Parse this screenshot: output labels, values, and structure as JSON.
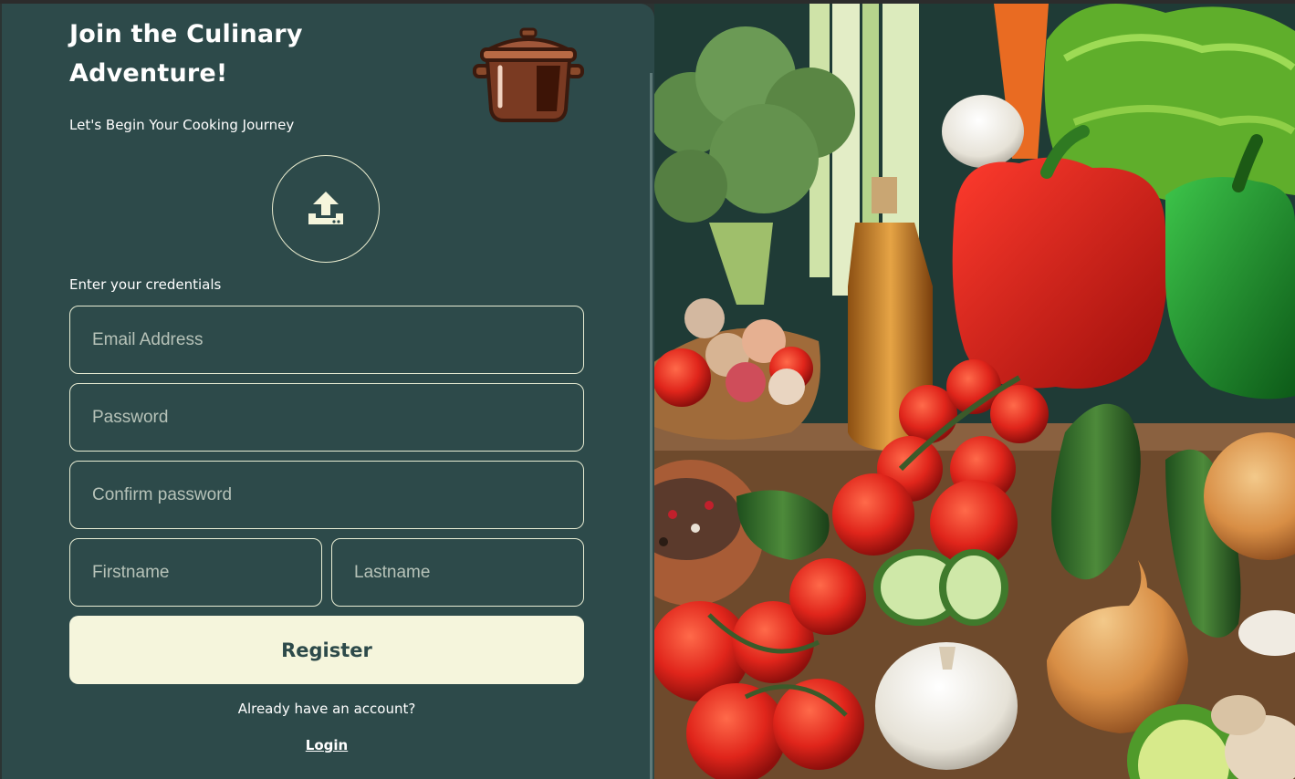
{
  "form": {
    "title": "Join the Culinary Adventure!",
    "subtitle": "Let's Begin Your Cooking Journey",
    "credentials_label": "Enter your credentials",
    "email_placeholder": "Email Address",
    "password_placeholder": "Password",
    "confirm_placeholder": "Confirm password",
    "firstname_placeholder": "Firstname",
    "lastname_placeholder": "Lastname",
    "register_label": "Register",
    "already_text": "Already have an account?",
    "login_label": "Login"
  },
  "icons": {
    "logo": "cooking-pot-icon",
    "upload": "upload-icon"
  },
  "colors": {
    "panel_bg": "#2d4a4a",
    "accent": "#f5f5dc",
    "text": "#ffffff"
  }
}
